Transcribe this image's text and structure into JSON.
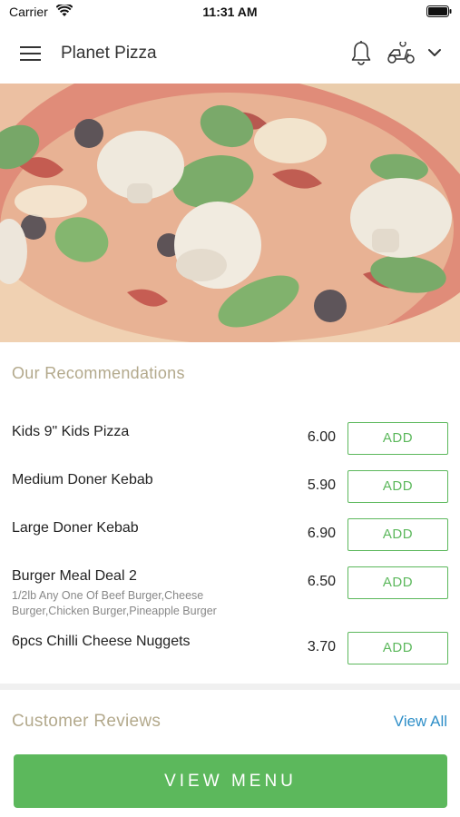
{
  "status_bar": {
    "carrier": "Carrier",
    "time": "11:31 AM",
    "icons": [
      "wifi-icon",
      "battery-icon"
    ]
  },
  "header": {
    "title": "Planet Pizza",
    "icons": [
      "menu-icon",
      "bell-icon",
      "scooter-icon",
      "chevron-down-icon"
    ]
  },
  "hero": {
    "icon": "pizza-hero-image"
  },
  "recommendations": {
    "title": "Our Recommendations",
    "items": [
      {
        "name": "Kids 9\" Kids Pizza",
        "description": "",
        "price": "6.00",
        "button": "ADD"
      },
      {
        "name": "Medium Doner Kebab",
        "description": "",
        "price": "5.90",
        "button": "ADD"
      },
      {
        "name": "Large Doner Kebab",
        "description": "",
        "price": "6.90",
        "button": "ADD"
      },
      {
        "name": "Burger Meal Deal 2",
        "description": "1/2lb Any One Of Beef Burger,Cheese Burger,Chicken Burger,Pineapple Burger",
        "price": "6.50",
        "button": "ADD"
      },
      {
        "name": "6pcs Chilli Cheese Nuggets",
        "description": "",
        "price": "3.70",
        "button": "ADD"
      }
    ]
  },
  "reviews": {
    "title": "Customer Reviews",
    "link": "View All"
  },
  "footer": {
    "button": "VIEW MENU"
  },
  "colors": {
    "accent_green": "#5cb85c",
    "section_title": "#b3a98c",
    "link_blue": "#2f8fc8"
  }
}
